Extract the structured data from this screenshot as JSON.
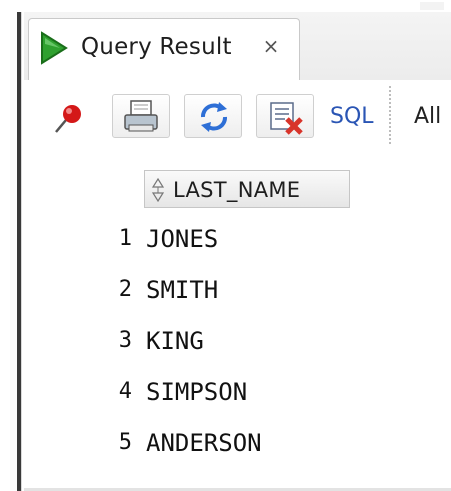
{
  "tab": {
    "title": "Query Result",
    "close_glyph": "×",
    "icon": "run-triangle-icon"
  },
  "toolbar": {
    "buttons": [
      {
        "name": "freeze-view-pin-icon",
        "interactable": true
      },
      {
        "name": "print-icon",
        "interactable": true
      },
      {
        "name": "refresh-icon",
        "interactable": true
      },
      {
        "name": "clear-results-icon",
        "interactable": true
      }
    ],
    "sql_label": "SQL",
    "all_label": "All"
  },
  "grid": {
    "columns": [
      "LAST_NAME"
    ],
    "rows": [
      {
        "num": "1",
        "last_name": "JONES"
      },
      {
        "num": "2",
        "last_name": "SMITH"
      },
      {
        "num": "3",
        "last_name": "KING"
      },
      {
        "num": "4",
        "last_name": "SIMPSON"
      },
      {
        "num": "5",
        "last_name": "ANDERSON"
      }
    ]
  },
  "colors": {
    "run_icon": "#2fa12f",
    "pin": "#d41818",
    "sql_link": "#2a55b4",
    "refresh": "#2e6fd6",
    "clear_x": "#d8342a"
  }
}
